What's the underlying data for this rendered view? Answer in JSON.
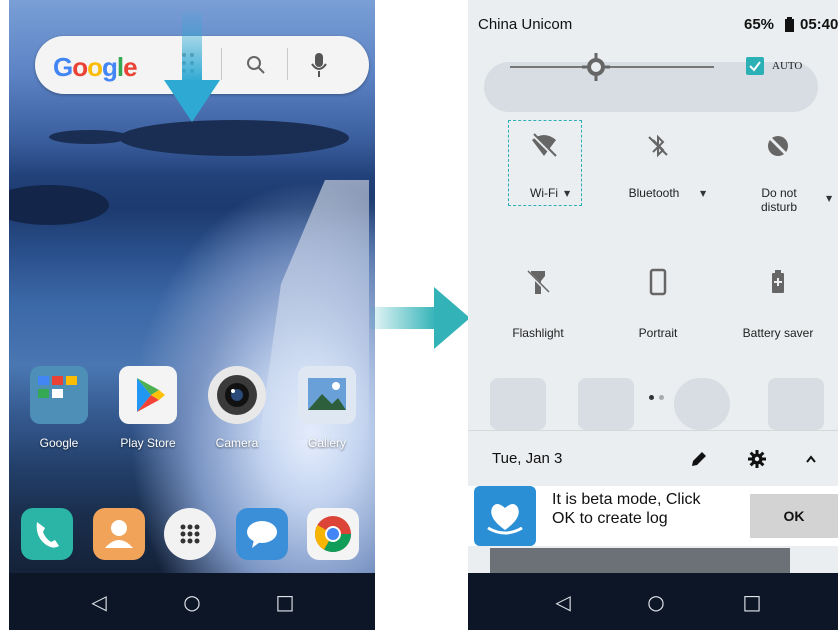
{
  "left_screen": {
    "search_logo": "Google",
    "apps": [
      {
        "label": "Google"
      },
      {
        "label": "Play Store"
      },
      {
        "label": "Camera"
      },
      {
        "label": "Gallery"
      }
    ],
    "dock": [
      "phone-icon",
      "contacts-icon",
      "app-drawer-icon",
      "messages-icon",
      "chrome-icon"
    ],
    "nav": {
      "back": "◁",
      "home": "○",
      "recents": "□"
    }
  },
  "right_screen": {
    "status": {
      "carrier": "China Unicom",
      "battery": "65%",
      "time": "05:40"
    },
    "brightness": {
      "auto_label": "AUTO",
      "auto_checked": true,
      "level": 0.42
    },
    "tiles_row1": [
      {
        "label": "Wi-Fi",
        "icon": "wifi-off-icon",
        "has_dropdown": true,
        "highlighted": true
      },
      {
        "label": "Bluetooth",
        "icon": "bluetooth-off-icon",
        "has_dropdown": true
      },
      {
        "label": "Do not\ndisturb",
        "icon": "do-not-disturb-icon",
        "has_dropdown": true
      }
    ],
    "tiles_row2": [
      {
        "label": "Flashlight",
        "icon": "flashlight-icon"
      },
      {
        "label": "Portrait",
        "icon": "portrait-icon"
      },
      {
        "label": "Battery saver",
        "icon": "battery-saver-icon"
      }
    ],
    "page_dots": {
      "current": 1,
      "total": 2
    },
    "footer": {
      "date": "Tue, Jan 3"
    },
    "beta": {
      "message_line1": "It is beta mode, Click",
      "message_line2": "OK to create log",
      "ok_label": "OK"
    },
    "nav": {
      "back": "◁",
      "home": "○",
      "recents": "□"
    }
  },
  "colors": {
    "accent": "#2bb0b6",
    "auto_check": "#2bb0b6",
    "arrow_down": "#2ea9d4",
    "arrow_right": "#33b3b8"
  }
}
